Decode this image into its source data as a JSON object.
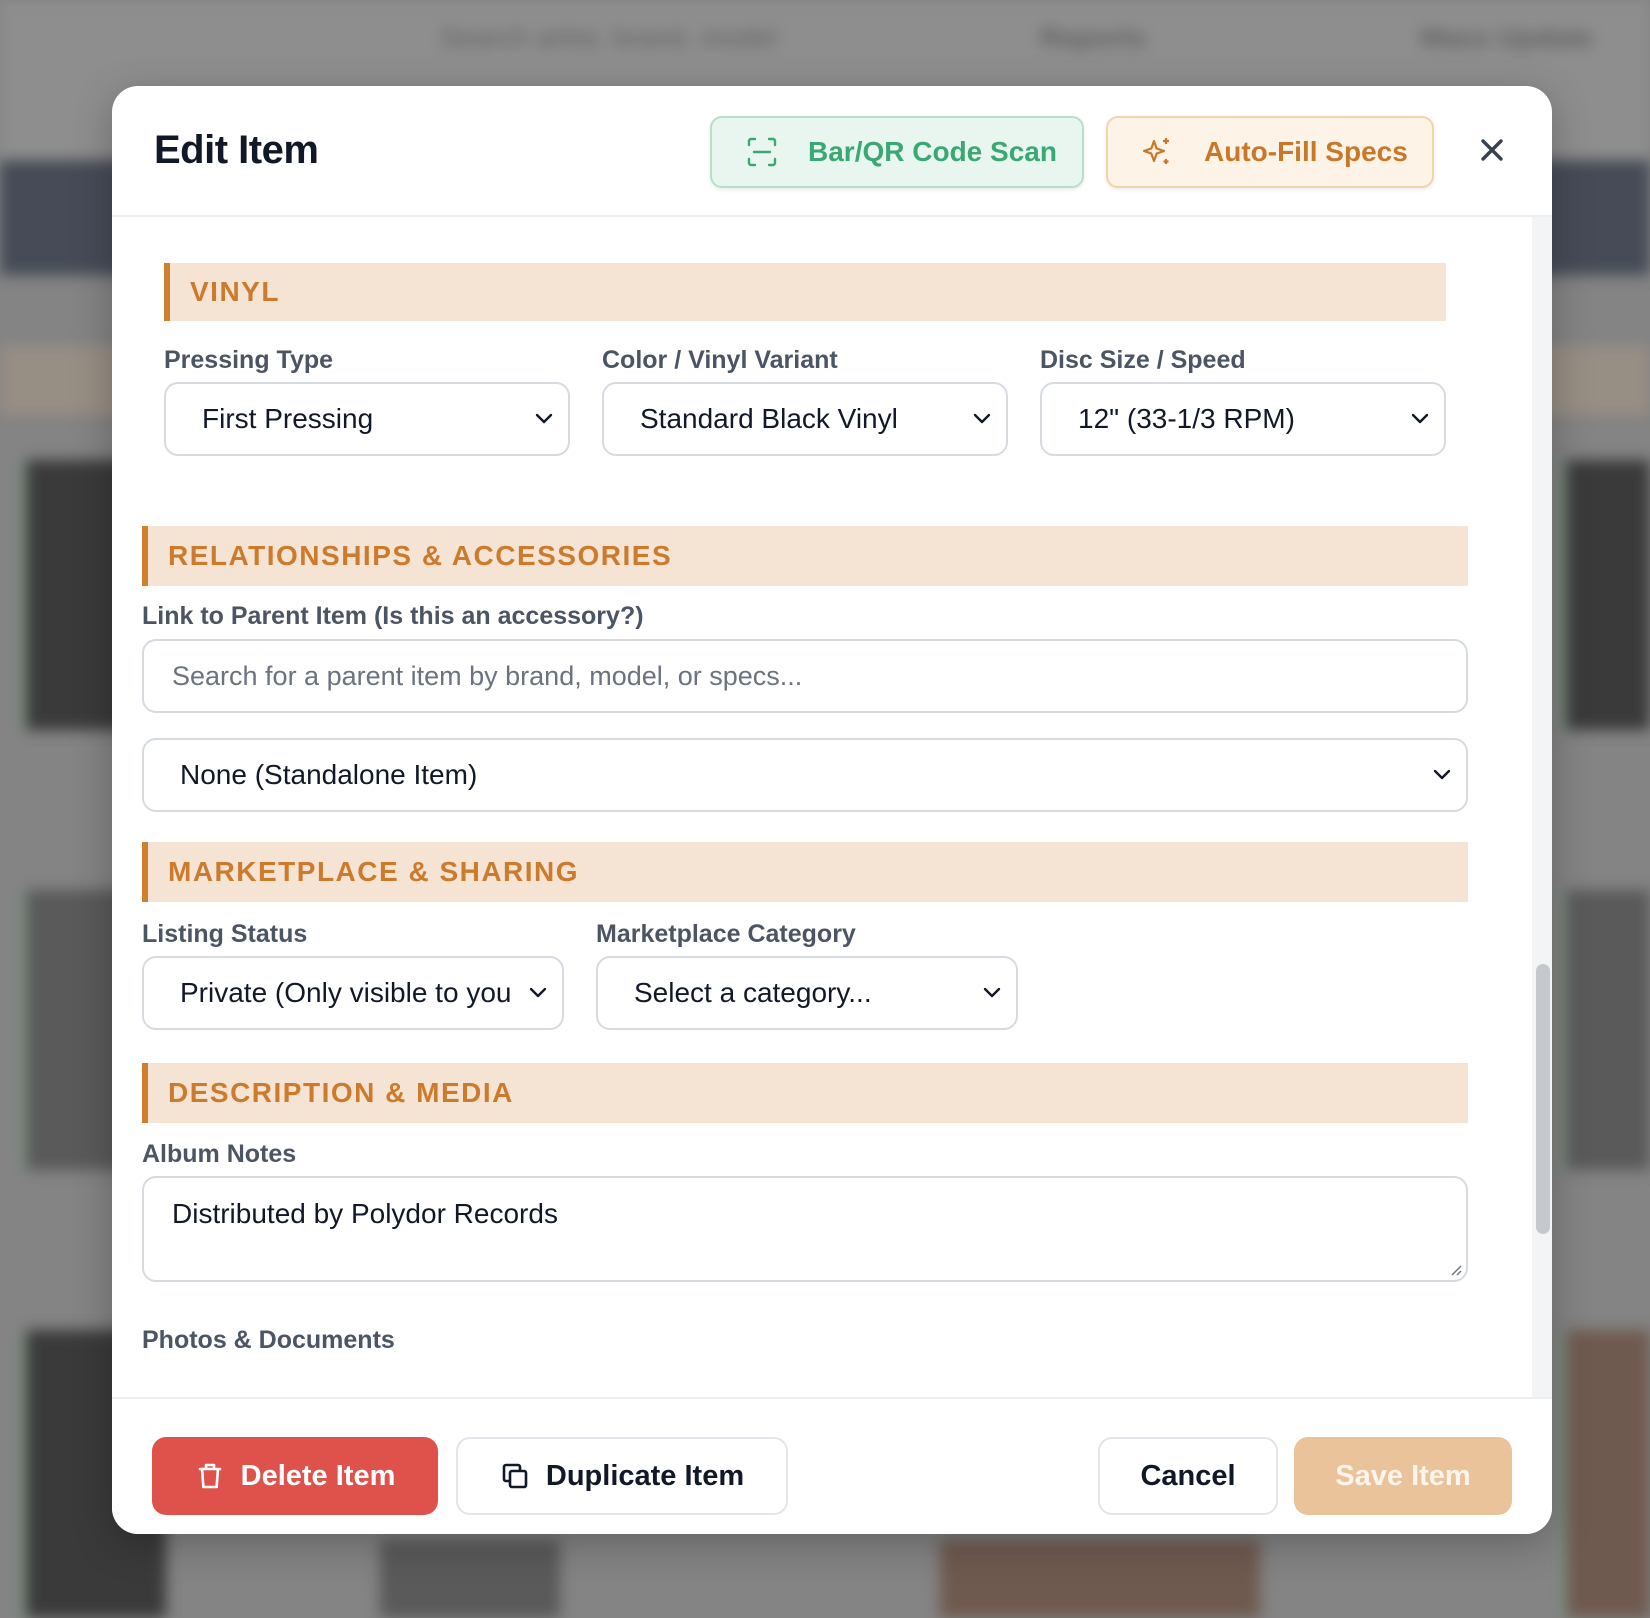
{
  "background": {
    "search_placeholder": "Search artist, brand, model",
    "reports_label": "Reports",
    "mass_update_label": "Mass Update"
  },
  "modal": {
    "title": "Edit Item",
    "scan_button": "Bar/QR Code Scan",
    "autofill_button": "Auto-Fill Specs",
    "close_glyph": "✕"
  },
  "sections": {
    "vinyl": {
      "title": "VINYL",
      "pressing_type_label": "Pressing Type",
      "pressing_type_value": "First Pressing",
      "color_label": "Color / Vinyl Variant",
      "color_value": "Standard Black Vinyl",
      "disc_label": "Disc Size / Speed",
      "disc_value": "12\" (33-1/3 RPM)"
    },
    "relationships": {
      "title": "RELATIONSHIPS & ACCESSORIES",
      "parent_label": "Link to Parent Item (Is this an accessory?)",
      "parent_search_placeholder": "Search for a parent item by brand, model, or specs...",
      "parent_select_value": "None (Standalone Item)"
    },
    "marketplace": {
      "title": "MARKETPLACE & SHARING",
      "listing_status_label": "Listing Status",
      "listing_status_value": "Private (Only visible to you)",
      "category_label": "Marketplace Category",
      "category_value": "Select a category..."
    },
    "description": {
      "title": "DESCRIPTION & MEDIA",
      "notes_label": "Album Notes",
      "notes_value": "Distributed by Polydor Records",
      "photos_label": "Photos & Documents"
    }
  },
  "footer": {
    "delete_label": "Delete Item",
    "duplicate_label": "Duplicate Item",
    "cancel_label": "Cancel",
    "save_label": "Save Item"
  },
  "colors": {
    "accent_orange": "#cc7a2c",
    "section_bg": "#f5e4d4",
    "scan_green": "#3aa872",
    "delete_red": "#df524c",
    "save_disabled": "#ebc39b"
  },
  "icons": {
    "scan": "scan-frame-icon",
    "autofill": "sparkles-icon",
    "close": "close-icon",
    "chevron": "chevron-down-icon",
    "delete": "trash-icon",
    "duplicate": "copy-icon"
  }
}
